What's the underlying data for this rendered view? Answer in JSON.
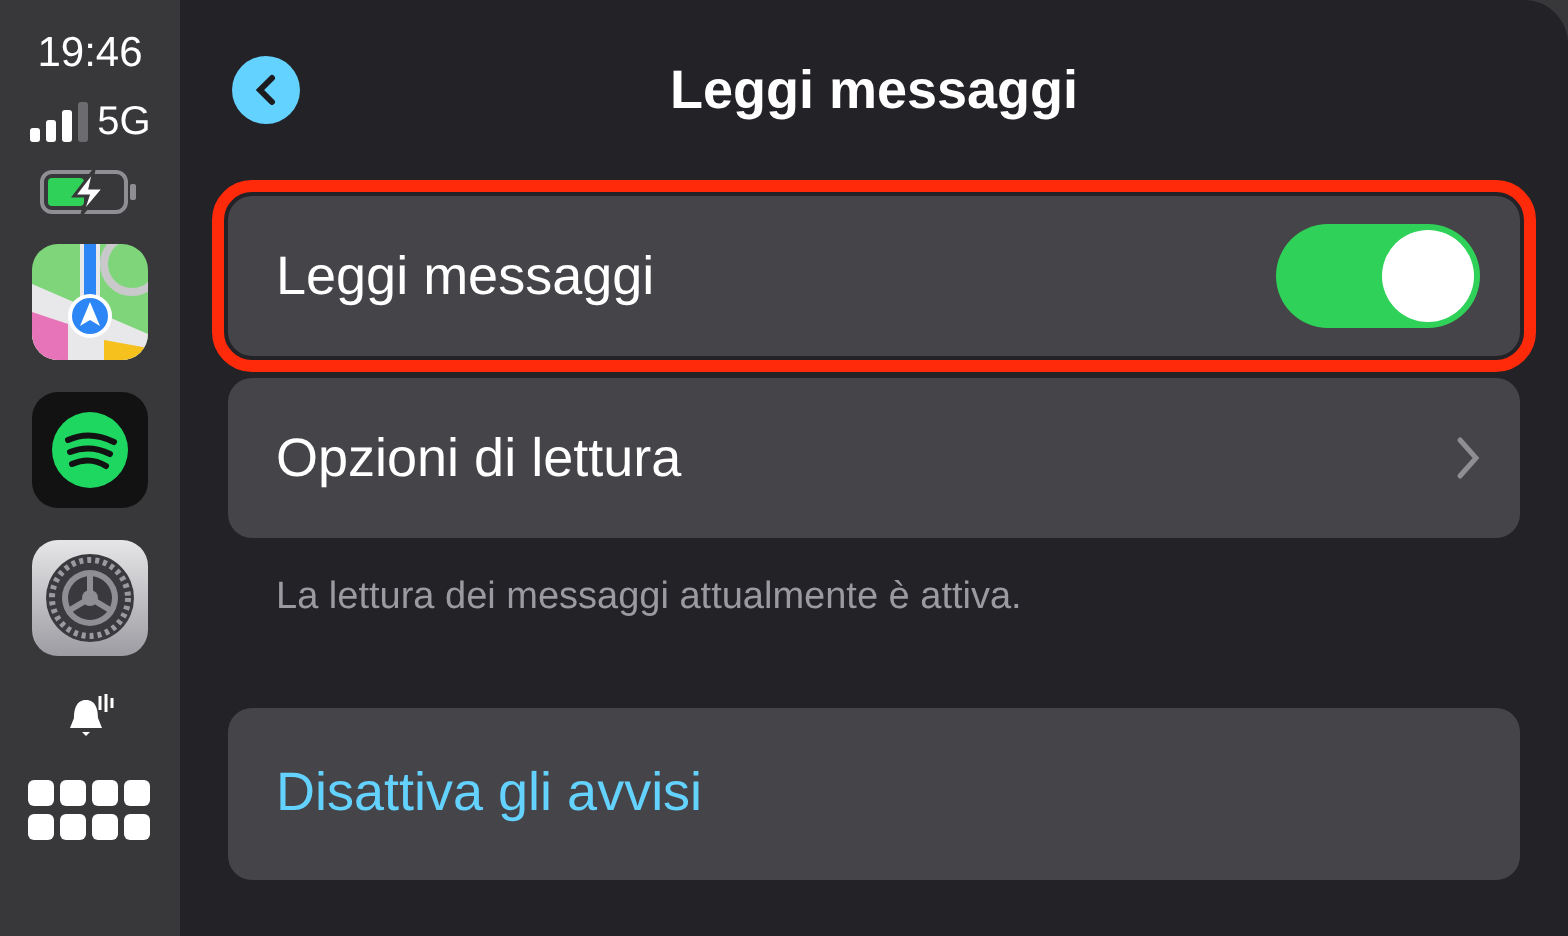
{
  "status": {
    "time": "19:46",
    "network": "5G"
  },
  "dock": [
    {
      "kind": "maps"
    },
    {
      "kind": "spotify"
    },
    {
      "kind": "settings"
    }
  ],
  "header": {
    "title": "Leggi messaggi"
  },
  "rows": [
    {
      "kind": "toggle",
      "label": "Leggi messaggi",
      "on": true,
      "highlighted": true
    },
    {
      "kind": "link",
      "label": "Opzioni di lettura",
      "highlighted": false
    }
  ],
  "footnote": "La lettura dei messaggi attualmente è attiva.",
  "action": {
    "label": "Disattiva gli avvisi"
  }
}
